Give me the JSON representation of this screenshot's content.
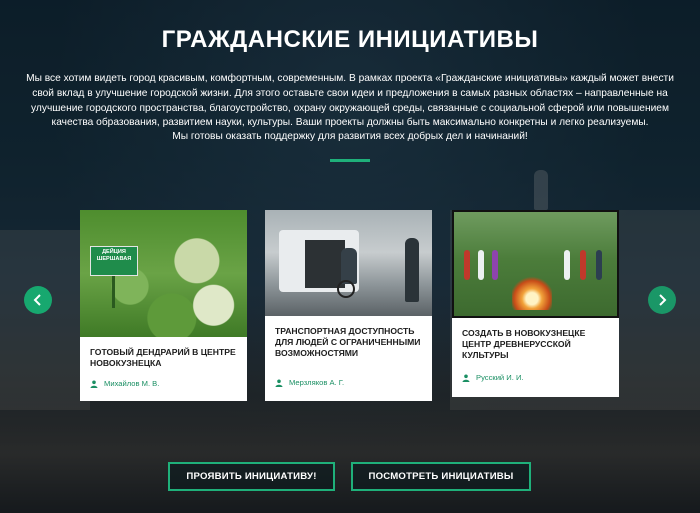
{
  "header": {
    "title": "ГРАЖДАНСКИЕ ИНИЦИАТИВЫ",
    "intro": "Мы все хотим видеть город красивым, комфортным, современным. В рамках проекта «Гражданские инициативы» каждый может внести свой вклад в улучшение городской жизни. Для этого оставьте свои идеи и предложения в самых разных областях – направленные на улучшение городского пространства, благоустройство, охрану окружающей среды, связанные с социальной сферой или повышением качества образования, развитием науки, культуры. Ваши проекты должны быть максимально конкретны и легко реализуемы.",
    "support": "Мы готовы оказать поддержку для развития всех добрых дел и начинаний!"
  },
  "slider": {
    "prev_icon": "chevron-left-icon",
    "next_icon": "chevron-right-icon",
    "accent_color": "#17a86f",
    "cards": [
      {
        "title": "ГОТОВЫЙ ДЕНДРАРИЙ В ЦЕНТРЕ НОВОКУЗНЕЦКА",
        "author": "Михайлов М. В.",
        "sign_text": "ДЕЙЦИЯ ШЕРШАВАЯ"
      },
      {
        "title": "ТРАНСПОРТНАЯ ДОСТУПНОСТЬ ДЛЯ ЛЮДЕЙ С ОГРАНИЧЕННЫМИ ВОЗМОЖНОСТЯМИ",
        "author": "Мерзляков А. Г."
      },
      {
        "title": "СОЗДАТЬ В НОВОКУЗНЕЦКЕ ЦЕНТР ДРЕВНЕРУССКОЙ КУЛЬТУРЫ",
        "author": "Русский И. И."
      }
    ]
  },
  "actions": {
    "propose_label": "ПРОЯВИТЬ ИНИЦИАТИВУ!",
    "view_label": "ПОСМОТРЕТЬ ИНИЦИАТИВЫ"
  }
}
